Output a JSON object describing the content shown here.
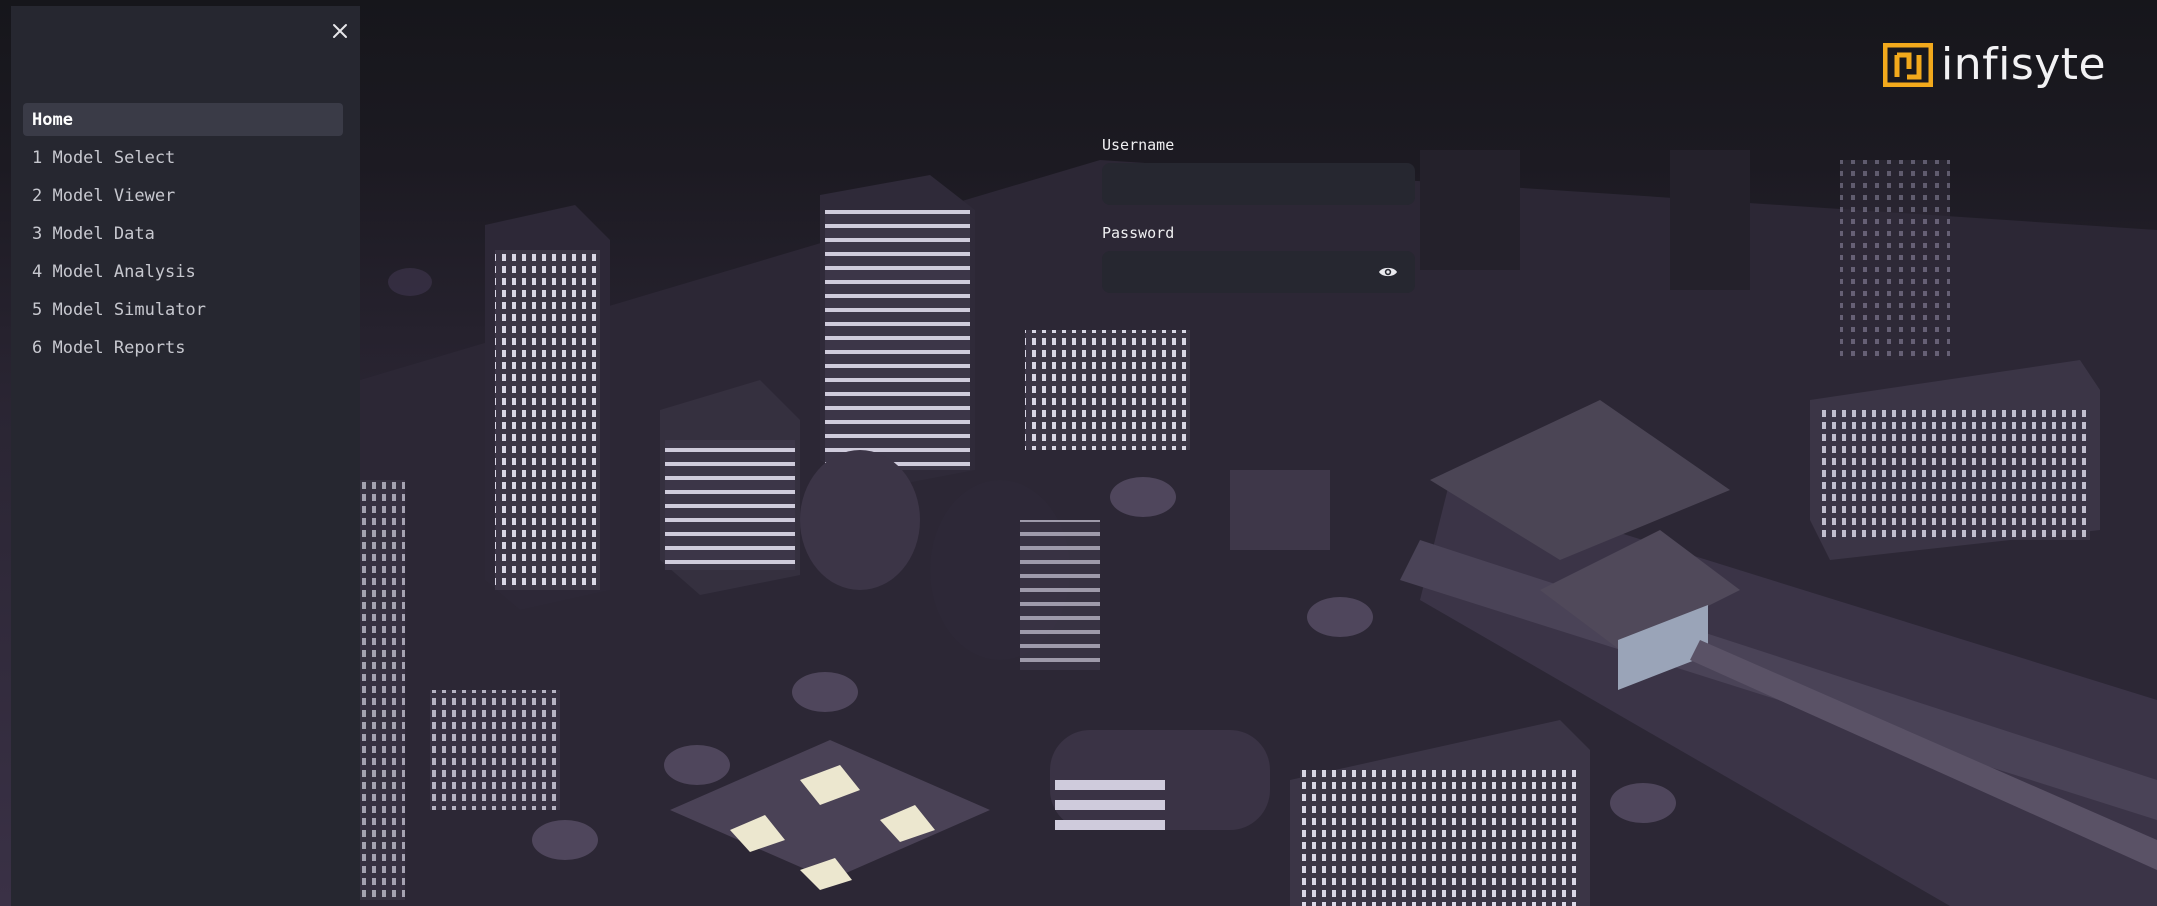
{
  "app": {
    "brand": "infisyte",
    "accent_color": "#f2a91c"
  },
  "sidebar": {
    "close_icon": "close-icon",
    "items": [
      {
        "label": "Home",
        "active": true
      },
      {
        "label": "1 Model Select",
        "active": false
      },
      {
        "label": "2 Model Viewer",
        "active": false
      },
      {
        "label": "3 Model Data",
        "active": false
      },
      {
        "label": "4 Model Analysis",
        "active": false
      },
      {
        "label": "5 Model Simulator",
        "active": false
      },
      {
        "label": "6 Model Reports",
        "active": false
      }
    ]
  },
  "login": {
    "username_label": "Username",
    "username_value": "",
    "password_label": "Password",
    "password_value": "",
    "toggle_icon": "eye-icon"
  }
}
